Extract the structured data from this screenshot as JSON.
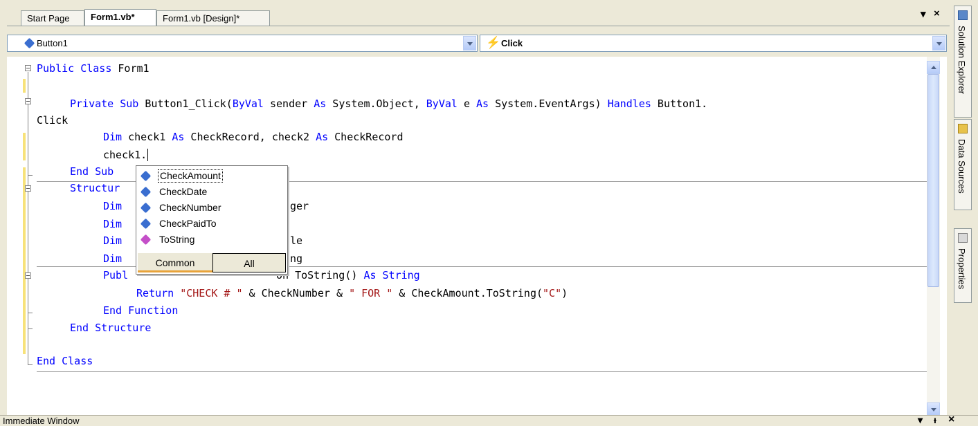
{
  "tabs": [
    "Start Page",
    "Form1.vb*",
    "Form1.vb [Design]*"
  ],
  "window_buttons": {
    "dropdown": "▾",
    "close": "×"
  },
  "combos": {
    "object": "Button1",
    "event": "Click"
  },
  "code": {
    "l1_kw": "Public Class",
    "l1_rest": " Form1",
    "l2_kw1": "Private Sub",
    "l2_a": " Button1_Click(",
    "l2_kw2": "ByVal",
    "l2_b": " sender ",
    "l2_kw3": "As",
    "l2_c": " System.Object, ",
    "l2_kw4": "ByVal",
    "l2_d": " e ",
    "l2_kw5": "As",
    "l2_e": " System.EventArgs) ",
    "l2_kw6": "Handles",
    "l2_f": " Button1.",
    "l3": "Click",
    "l4_kw1": "Dim",
    "l4_a": " check1 ",
    "l4_kw2": "As",
    "l4_b": " CheckRecord, check2 ",
    "l4_kw3": "As",
    "l4_c": " CheckRecord",
    "l5": "check1.",
    "l6": "End Sub",
    "l7": "Structur",
    "l8_kw": "Dim",
    "l8_rest": "ger",
    "l9_kw": "Dim",
    "l10_kw": "Dim",
    "l10_rest": "le",
    "l11_kw": "Dim",
    "l11_rest": "ng",
    "l12_kw1": "Publ",
    "l12_a": "on ToString() ",
    "l12_kw2": "As String",
    "l13_kw": "Return",
    "l13_s1": " \"CHECK # \"",
    "l13_a": " & CheckNumber & ",
    "l13_s2": "\" FOR \"",
    "l13_b": " & CheckAmount.ToString(",
    "l13_s3": "\"C\"",
    "l13_c": ")",
    "l14": "End Function",
    "l15": "End Structure",
    "l16": "End Class"
  },
  "intellisense": {
    "items": [
      "CheckAmount",
      "CheckDate",
      "CheckNumber",
      "CheckPaidTo",
      "ToString"
    ],
    "tabs": [
      "Common",
      "All"
    ]
  },
  "side_tabs": [
    "Solution Explorer",
    "Data Sources",
    "Properties"
  ],
  "bottom": {
    "title": "Immediate Window",
    "pin": "ᵻ",
    "close": "×",
    "dropdown": "▾"
  }
}
